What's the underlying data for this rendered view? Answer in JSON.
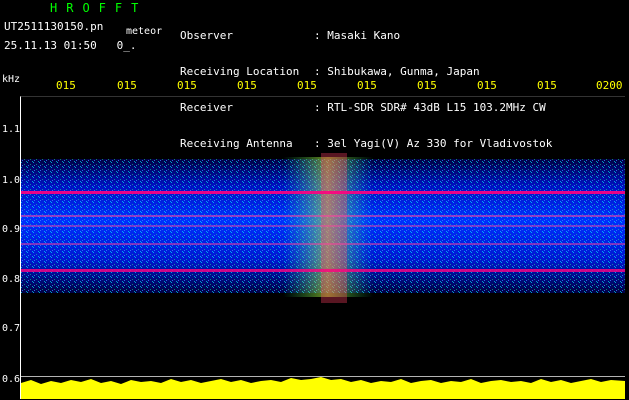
{
  "header": {
    "app_title": "HROFFT",
    "file_name": "UT2511130150.pn",
    "meteor_label": "meteor",
    "datetime": "25.11.13 01:50   0_."
  },
  "meta": [
    {
      "key": "Observer",
      "value": ": Masaki Kano"
    },
    {
      "key": "Receiving Location",
      "value": ": Shibukawa, Gunma, Japan"
    },
    {
      "key": "Receiver",
      "value": ": RTL-SDR SDR# 43dB L15 103.2MHz CW"
    },
    {
      "key": "Receiving Antenna",
      "value": ": 3el Yagi(V) Az 330 for Vladivostok"
    }
  ],
  "axis": {
    "unit": "kHz",
    "y_ticks": [
      "1.1",
      "1.0",
      "0.9",
      "0.8",
      "0.7",
      "0.6"
    ],
    "x_ticks": [
      "015",
      "015",
      "015",
      "015",
      "015",
      "015",
      "015",
      "015",
      "015",
      "0200"
    ]
  },
  "colors": {
    "title": "#00ff00",
    "tick_x": "#ffff00",
    "noise_low": "#0000ff",
    "noise_mid": "#00e0ff",
    "hot": "#ff0080",
    "bottom_trace": "#ffff00"
  }
}
